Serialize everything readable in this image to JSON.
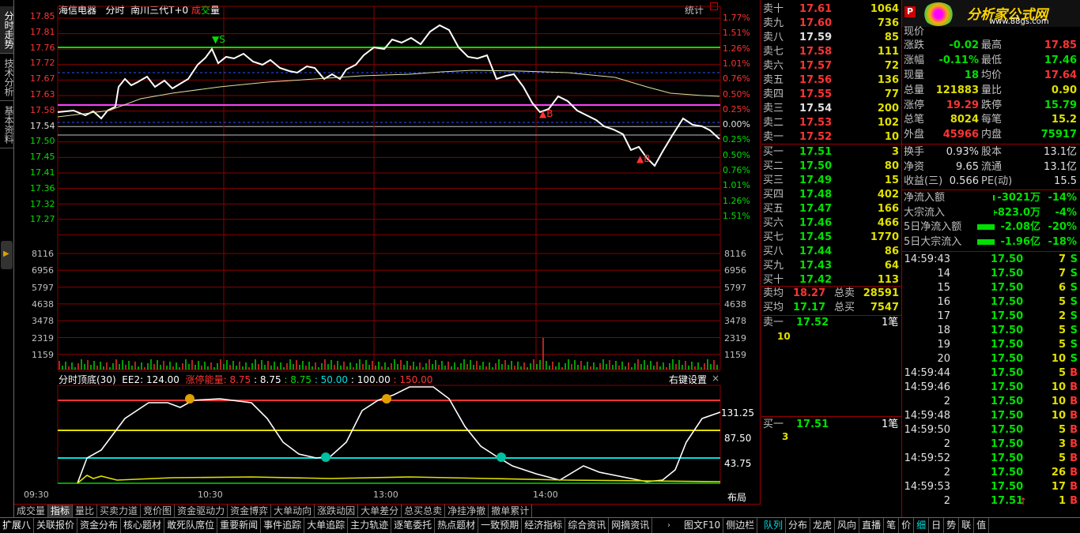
{
  "left_tabs": [
    "分时走势",
    "技术分析",
    "基本资料"
  ],
  "header": {
    "stock": "海信电器",
    "mode": "分时",
    "branch": "南川三代T+0",
    "ind_red": "成",
    "ind_green": "交",
    "ind_white": "量",
    "stat": "统计"
  },
  "price_axis": [
    "17.85",
    "17.81",
    "17.76",
    "17.72",
    "17.67",
    "17.63",
    "17.58",
    "17.54",
    "17.50",
    "17.45",
    "17.41",
    "17.36",
    "17.32",
    "17.27"
  ],
  "pct_axis": [
    "1.77%",
    "1.51%",
    "1.26%",
    "1.01%",
    "0.76%",
    "0.50%",
    "0.25%",
    "0.00%",
    "0.25%",
    "0.50%",
    "0.76%",
    "1.01%",
    "1.26%",
    "1.51%"
  ],
  "vol_axis": [
    "8116",
    "6956",
    "5797",
    "4638",
    "3478",
    "2319",
    "1159"
  ],
  "times": [
    "09:30",
    "10:30",
    "13:00",
    "14:00"
  ],
  "markers": {
    "s": "S",
    "b1": "B",
    "b2": "B"
  },
  "sub": {
    "title": "分时顶底(30)",
    "ee2": "EE2: 124.00",
    "zt": "涨停能量",
    "v1": ": 8.75",
    "v2": ": 8.75",
    "v3": ": 8.75",
    "v4": ": 50.00",
    "v5": ": 100.00",
    "v6": ": 150.00",
    "setting": "右键设置",
    "close": "×",
    "axis": [
      "131.25",
      "87.50",
      "43.75"
    ]
  },
  "layout_btn": "布局",
  "bottom_tabs": [
    "成交量",
    "指标",
    "量比",
    "买卖力道",
    "竞价图",
    "资金驱动力",
    "资金博弈",
    "大单动向",
    "涨跌动因",
    "大单差分",
    "总买总卖",
    "净挂净撤",
    "撤单累计"
  ],
  "sell": [
    [
      "卖十",
      "17.61",
      "1064"
    ],
    [
      "卖九",
      "17.60",
      "736"
    ],
    [
      "卖八",
      "17.59",
      "85"
    ],
    [
      "卖七",
      "17.58",
      "111"
    ],
    [
      "卖六",
      "17.57",
      "72"
    ],
    [
      "卖五",
      "17.56",
      "136"
    ],
    [
      "卖四",
      "17.55",
      "77"
    ],
    [
      "卖三",
      "17.54",
      "200"
    ],
    [
      "卖二",
      "17.53",
      "102"
    ],
    [
      "卖一",
      "17.52",
      "10"
    ]
  ],
  "buy": [
    [
      "买一",
      "17.51",
      "3"
    ],
    [
      "买二",
      "17.50",
      "80"
    ],
    [
      "买三",
      "17.49",
      "15"
    ],
    [
      "买四",
      "17.48",
      "402"
    ],
    [
      "买五",
      "17.47",
      "166"
    ],
    [
      "买六",
      "17.46",
      "466"
    ],
    [
      "买七",
      "17.45",
      "1770"
    ],
    [
      "买八",
      "17.44",
      "86"
    ],
    [
      "买九",
      "17.43",
      "64"
    ],
    [
      "买十",
      "17.42",
      "113"
    ]
  ],
  "avg": {
    "sell_avg_lbl": "卖均",
    "sell_avg": "18.27",
    "sell_total_lbl": "总卖",
    "sell_total": "28591",
    "buy_avg_lbl": "买均",
    "buy_avg": "17.17",
    "buy_total_lbl": "总买",
    "buy_total": "7547"
  },
  "queue": {
    "sell1_lbl": "卖一",
    "sell1_price": "17.52",
    "sell1_count": "1笔",
    "sell1_vol": "10",
    "buy1_lbl": "买一",
    "buy1_price": "17.51",
    "buy1_count": "1笔",
    "buy1_vol": "3"
  },
  "logo": {
    "badge": "P",
    "title": "分析家公式网",
    "url": "www.88gs.com"
  },
  "stats": [
    [
      "现价",
      "",
      "最高",
      "17.85"
    ],
    [
      "涨跌",
      "-0.02",
      "最高",
      "17.85"
    ],
    [
      "涨幅",
      "-0.11%",
      "最低",
      "17.46"
    ],
    [
      "现量",
      "18",
      "均价",
      "17.64"
    ],
    [
      "总量",
      "121883",
      "量比",
      "0.90"
    ],
    [
      "涨停",
      "19.29",
      "跌停",
      "15.79"
    ],
    [
      "总笔",
      "8024",
      "每笔",
      "15.2"
    ],
    [
      "外盘",
      "45966",
      "内盘",
      "75917"
    ]
  ],
  "stats2": [
    [
      "换手",
      "0.93%",
      "股本",
      "13.1亿"
    ],
    [
      "净资",
      "9.65",
      "流通",
      "13.1亿"
    ],
    [
      "收益(三)",
      "0.566",
      "PE(动)",
      "15.5"
    ]
  ],
  "flows": [
    [
      "净流入额",
      "-3021万",
      "-14%"
    ],
    [
      "大宗流入",
      "-823.0万",
      "-4%"
    ],
    [
      "5日净流入额",
      "-2.08亿",
      "-20%"
    ],
    [
      "5日大宗流入",
      "-1.96亿",
      "-18%"
    ]
  ],
  "ticks": [
    [
      "14:59:43",
      "17.50",
      "7",
      "S"
    ],
    [
      "14",
      "17.50",
      "7",
      "S"
    ],
    [
      "15",
      "17.50",
      "6",
      "S"
    ],
    [
      "16",
      "17.50",
      "5",
      "S"
    ],
    [
      "17",
      "17.50",
      "2",
      "S"
    ],
    [
      "18",
      "17.50",
      "5",
      "S"
    ],
    [
      "19",
      "17.50",
      "5",
      "S"
    ],
    [
      "20",
      "17.50",
      "10",
      "S"
    ],
    [
      "14:59:44",
      "17.50",
      "5",
      "B"
    ],
    [
      "14:59:46",
      "17.50",
      "10",
      "B"
    ],
    [
      "2",
      "17.50",
      "10",
      "B"
    ],
    [
      "14:59:48",
      "17.50",
      "10",
      "B"
    ],
    [
      "14:59:50",
      "17.50",
      "5",
      "B"
    ],
    [
      "2",
      "17.50",
      "3",
      "B"
    ],
    [
      "14:59:52",
      "17.50",
      "5",
      "B"
    ],
    [
      "2",
      "17.50",
      "26",
      "B"
    ],
    [
      "14:59:53",
      "17.50",
      "17",
      "B"
    ],
    [
      "2",
      "17.51",
      "1",
      "B"
    ]
  ],
  "toolbar_left": [
    "扩展八",
    "关联报价",
    "资金分布",
    "核心题材",
    "敢死队席位",
    "重要新闻",
    "事件追踪",
    "大单追踪",
    "主力轨迹",
    "逐笔委托",
    "热点题材",
    "一致预期",
    "经济指标",
    "综合资讯",
    "网摘资讯"
  ],
  "toolbar_mid": [
    "图文F10",
    "侧边栏"
  ],
  "toolbar_right": [
    "队列",
    "分布",
    "龙虎",
    "风向",
    "直播",
    "笔",
    "价",
    "细",
    "日",
    "势",
    "联",
    "值"
  ],
  "colors": {
    "red": "#ff3333",
    "green": "#00e000",
    "yellow": "#e0e000",
    "cyan": "#00e0e0",
    "magenta": "#ff40ff",
    "grid": "#8b0000"
  }
}
